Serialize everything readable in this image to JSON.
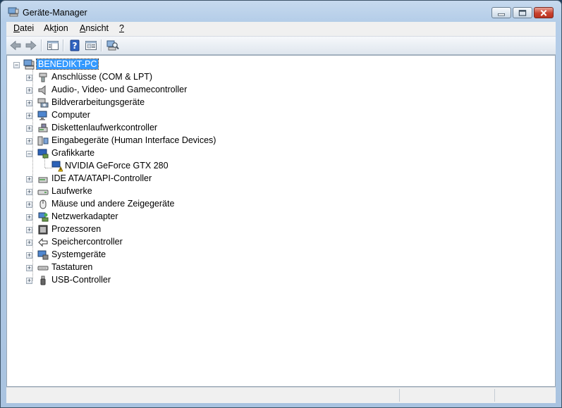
{
  "window": {
    "title": "Geräte-Manager"
  },
  "menubar": {
    "items": [
      {
        "label": "Datei"
      },
      {
        "label": "Aktion"
      },
      {
        "label": "Ansicht"
      },
      {
        "label": "?"
      }
    ]
  },
  "toolbar": {
    "buttons": [
      {
        "icon": "back-arrow-icon"
      },
      {
        "icon": "forward-arrow-icon"
      },
      {
        "icon": "show-hide-console-tree-icon"
      },
      {
        "icon": "help-icon"
      },
      {
        "icon": "properties-icon"
      },
      {
        "icon": "scan-hardware-icon"
      }
    ]
  },
  "tree": {
    "root": {
      "label": "BENEDIKT-PC",
      "icon": "computer-icon",
      "expanded": true
    },
    "categories": [
      {
        "label": "Anschlüsse (COM & LPT)",
        "icon": "port-icon",
        "expanded": false
      },
      {
        "label": "Audio-, Video- und Gamecontroller",
        "icon": "speaker-icon",
        "expanded": false
      },
      {
        "label": "Bildverarbeitungsgeräte",
        "icon": "camera-icon",
        "expanded": false
      },
      {
        "label": "Computer",
        "icon": "computer-icon",
        "expanded": false
      },
      {
        "label": "Diskettenlaufwerkcontroller",
        "icon": "floppy-controller-icon",
        "expanded": false
      },
      {
        "label": "Eingabegeräte (Human Interface Devices)",
        "icon": "hid-icon",
        "expanded": false
      },
      {
        "label": "Grafikkarte",
        "icon": "display-adapter-icon",
        "expanded": true,
        "children": [
          {
            "label": "NVIDIA GeForce GTX 280",
            "icon": "display-warning-icon"
          }
        ]
      },
      {
        "label": "IDE ATA/ATAPI-Controller",
        "icon": "ide-controller-icon",
        "expanded": false
      },
      {
        "label": "Laufwerke",
        "icon": "drive-icon",
        "expanded": false
      },
      {
        "label": "Mäuse und andere Zeigegeräte",
        "icon": "mouse-icon",
        "expanded": false
      },
      {
        "label": "Netzwerkadapter",
        "icon": "network-icon",
        "expanded": false
      },
      {
        "label": "Prozessoren",
        "icon": "processor-icon",
        "expanded": false
      },
      {
        "label": "Speichercontroller",
        "icon": "storage-controller-icon",
        "expanded": false
      },
      {
        "label": "Systemgeräte",
        "icon": "system-devices-icon",
        "expanded": false
      },
      {
        "label": "Tastaturen",
        "icon": "keyboard-icon",
        "expanded": false
      },
      {
        "label": "USB-Controller",
        "icon": "usb-icon",
        "expanded": false
      }
    ]
  },
  "colors": {
    "selection": "#3399ff",
    "close_button": "#c8412e",
    "window_frame": "#b4cde8"
  }
}
